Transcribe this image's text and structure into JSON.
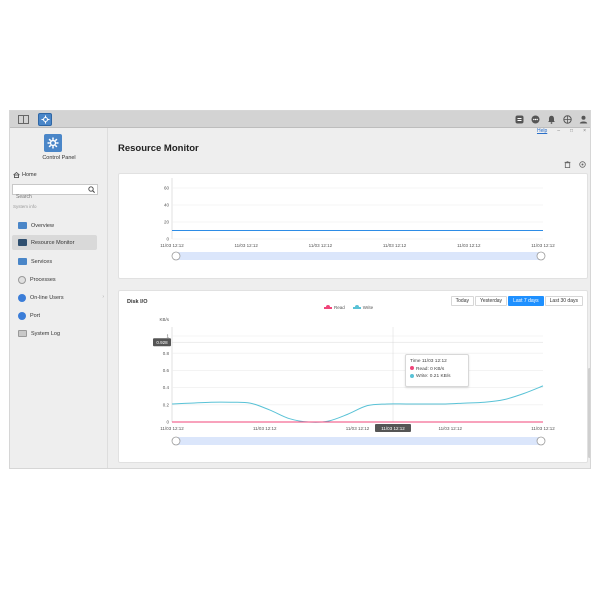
{
  "sidebar": {
    "app_title": "Control Panel",
    "home": "Home",
    "search_placeholder": "Search",
    "section": "System info",
    "items": [
      {
        "label": "Overview"
      },
      {
        "label": "Resource Monitor"
      },
      {
        "label": "Services"
      },
      {
        "label": "Processes"
      },
      {
        "label": "On-line Users"
      },
      {
        "label": "Port"
      },
      {
        "label": "System Log"
      }
    ]
  },
  "header": {
    "title": "Resource Monitor",
    "help": "Help",
    "minimize": "–",
    "restore": "□",
    "close": "×"
  },
  "top_chart": {
    "yticks": [
      "60",
      "40",
      "20",
      "0"
    ],
    "xticks": [
      "11/03 12:12",
      "11/03 12:12",
      "11/03 12:12",
      "11/03 12:12",
      "11/03 12:12",
      "11/03 12:12"
    ]
  },
  "disk_io": {
    "title": "Disk I/O",
    "ranges": [
      "Today",
      "Yesterday",
      "Last 7 days",
      "Last 30 days"
    ],
    "active_range": "Last 7 days",
    "unit": "KB/s",
    "yticks": [
      "1",
      "0.8",
      "0.6",
      "0.4",
      "0.2",
      "0"
    ],
    "cursor_value": "0.928",
    "cursor_time": "11/03 12:12",
    "xticks": [
      "11/03 12:12",
      "11/03 12:12",
      "11/03 12:12",
      "11/03 12:12",
      "11/03 12:12"
    ],
    "legend": [
      {
        "name": "Read",
        "color": "#f0457a"
      },
      {
        "name": "Write",
        "color": "#59c2d6"
      }
    ],
    "tooltip": {
      "time": "Time 11/03 12:12",
      "read": "Read:  0 KB/s",
      "write": "Write:  0.21 KB/s"
    }
  },
  "chart_data": [
    {
      "type": "line",
      "title": "",
      "x": [
        "11/03 12:12",
        "11/03 12:12",
        "11/03 12:12",
        "11/03 12:12",
        "11/03 12:12",
        "11/03 12:12"
      ],
      "series": [
        {
          "values": [
            10,
            10,
            10,
            10,
            10,
            10
          ]
        }
      ],
      "ylim": [
        0,
        60
      ],
      "grid": true
    },
    {
      "type": "line",
      "title": "Disk I/O",
      "ylabel": "KB/s",
      "x": [
        "11/03 12:12",
        "11/03 12:12",
        "11/03 12:12",
        "11/03 12:12",
        "11/03 12:12"
      ],
      "series": [
        {
          "name": "Read",
          "values": [
            0,
            0,
            0,
            0,
            0,
            0,
            0,
            0,
            0,
            0,
            0,
            0,
            0,
            0,
            0,
            0,
            0,
            0,
            0,
            0
          ]
        },
        {
          "name": "Write",
          "values": [
            0.21,
            0.22,
            0.23,
            0.23,
            0.22,
            0.14,
            0.04,
            0.0,
            0.01,
            0.09,
            0.19,
            0.21,
            0.21,
            0.21,
            0.21,
            0.22,
            0.23,
            0.26,
            0.33,
            0.42
          ]
        }
      ],
      "ylim": [
        0,
        1
      ],
      "grid": true,
      "legend": "top-center"
    }
  ]
}
